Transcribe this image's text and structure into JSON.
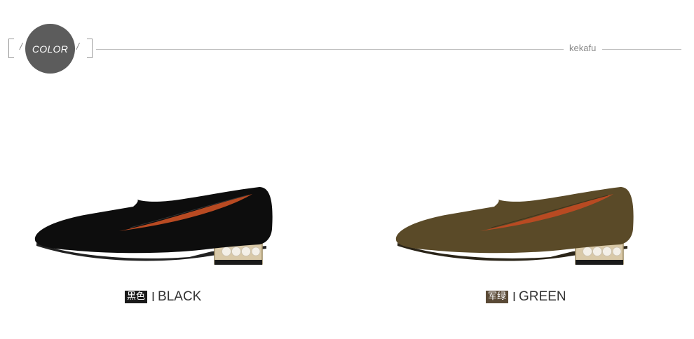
{
  "header": {
    "badge_label": "COLOR",
    "slash_left": "/",
    "slash_right": "/",
    "brand": "kekafu"
  },
  "variants": [
    {
      "cn": "黑色",
      "separator": "I",
      "en": "BLACK",
      "tag_color": "#1a1a1a",
      "shoe_color": "#111111"
    },
    {
      "cn": "军绿",
      "separator": "I",
      "en": "GREEN",
      "tag_color": "#5a4a36",
      "shoe_color": "#5a4a28"
    }
  ]
}
